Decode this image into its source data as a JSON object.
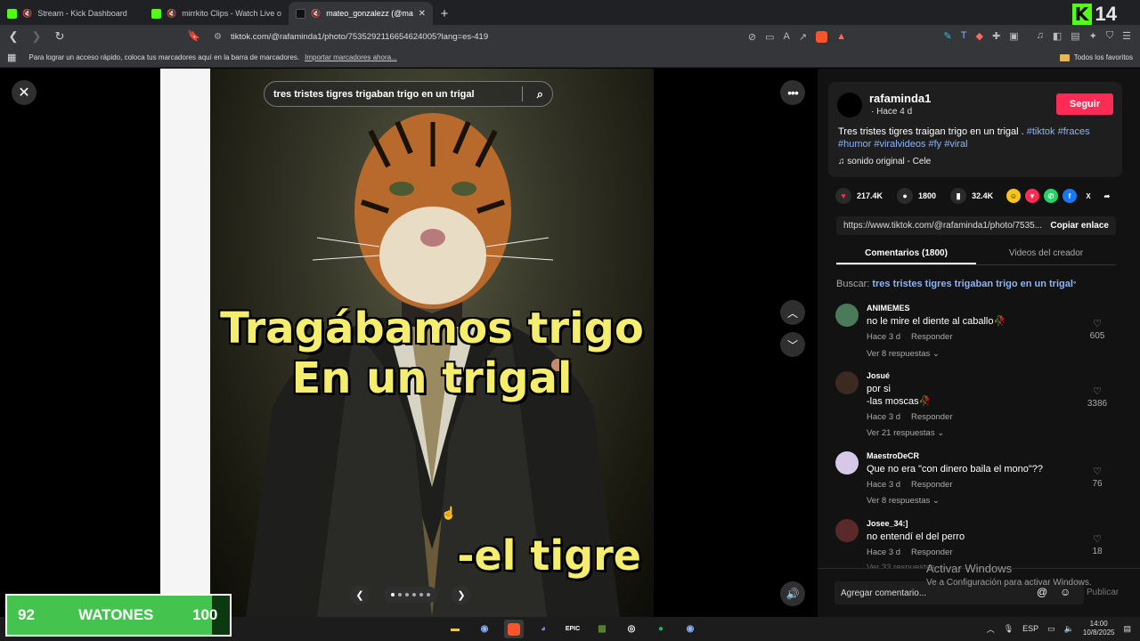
{
  "browser": {
    "tabs": [
      {
        "title": "Stream - Kick Dashboard",
        "favicon": "kick-icon",
        "color": "#53fc18"
      },
      {
        "title": "mirrkito Clips - Watch Live on Kick",
        "favicon": "kick-icon",
        "color": "#53fc18"
      },
      {
        "title": "mateo_gonzalezz (@mateo.gonzalezz)",
        "favicon": "tiktok-icon",
        "color": "#000000"
      }
    ],
    "kick_badge": "14",
    "url": "tiktok.com/@rafaminda1/photo/7535292116654624005?lang=es-419",
    "bookmarks_hint": "Para lograr un acceso rápido, coloca tus marcadores aquí en la barra de marcadores.",
    "bookmarks_link": "Importar marcadores ahora...",
    "all_favorites": "Todos los favoritos"
  },
  "viewer": {
    "search_text": "tres tristes tigres trigaban trigo en un trigal",
    "caption_top": "Tragábamos trigo\nEn un trigal",
    "caption_bottom": "-el tigre",
    "pager_dots": 6,
    "pager_active": 0
  },
  "post": {
    "username": "rafaminda1",
    "since": "· Hace 4 d",
    "follow_label": "Seguir",
    "desc_text": "Tres tristes tigres traigan trigo en un trigal . ",
    "hashtags": "#tiktok #fraces #humor #viralvideos #fy #viral",
    "sound": "sonido original - Cele",
    "likes": "217.4K",
    "comments": "1800",
    "saves": "32.4K",
    "link": "https://www.tiktok.com/@rafaminda1/photo/7535...",
    "copy_label": "Copiar enlace",
    "tab_comments": "Comentarios (1800)",
    "tab_videos": "Videos del creador",
    "buscar_label": "Buscar:",
    "buscar_query": "tres tristes tigres trigaban trigo en un trigal"
  },
  "comments": [
    {
      "name": "ANIMEMES",
      "text": "no le mire el diente al caballo🥀",
      "time": "Hace 3 d",
      "reply": "Responder",
      "likes": "605",
      "replies": "Ver 8 respuestas ⌄"
    },
    {
      "name": "Josué",
      "text": "por si\n-las moscas🥀",
      "time": "Hace 3 d",
      "reply": "Responder",
      "likes": "3386",
      "replies": "Ver 21 respuestas ⌄"
    },
    {
      "name": "MaestroDeCR",
      "text": "Que no era \"con dinero baila el mono\"??",
      "time": "Hace 3 d",
      "reply": "Responder",
      "likes": "76",
      "replies": "Ver 8 respuestas ⌄"
    },
    {
      "name": "Josee_34:]",
      "text": "no entendí el del perro",
      "time": "Hace 3 d",
      "reply": "Responder",
      "likes": "18",
      "replies": "Ver 33 respuestas"
    }
  ],
  "add_comment": {
    "placeholder": "Agregar comentario...",
    "publish": "Publicar"
  },
  "windows": {
    "activate_title": "Activar Windows",
    "activate_sub": "Ve a Configuración para activar Windows."
  },
  "taskbar": {
    "lang": "ESP",
    "time": "14:00",
    "date": "10/8/2025"
  },
  "overlay": {
    "left": "92",
    "label": "WATONES",
    "right": "100"
  }
}
